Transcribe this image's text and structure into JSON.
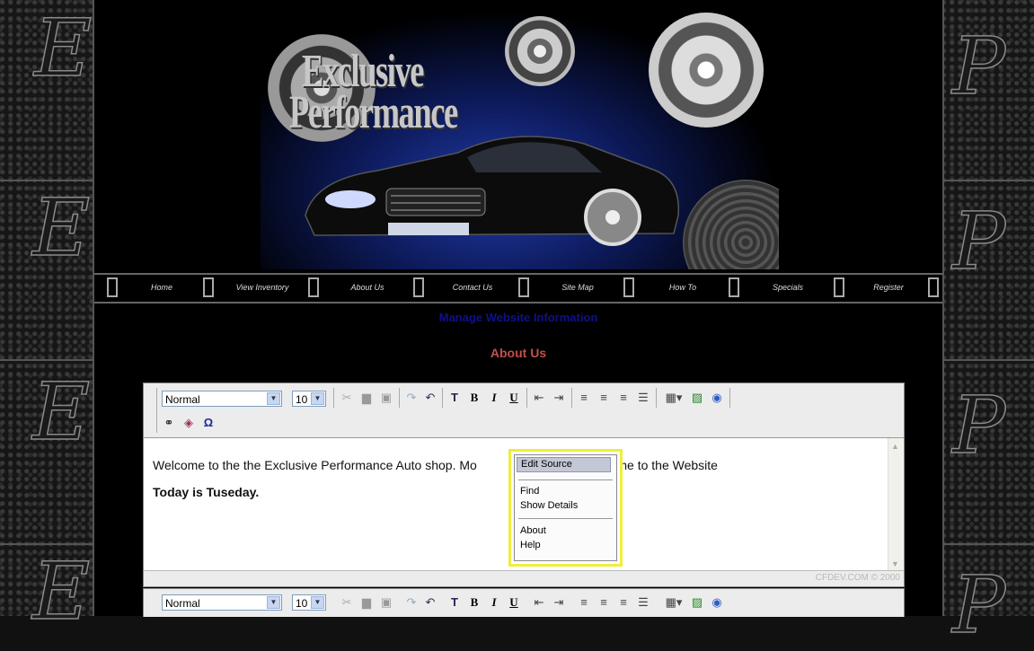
{
  "banner": {
    "logo_line1": "Exclusive",
    "logo_line2": "Performance"
  },
  "side": {
    "letters": [
      "E",
      "P"
    ]
  },
  "nav": {
    "items": [
      "Home",
      "View Inventory",
      "About Us",
      "Contact Us",
      "Site Map",
      "How To",
      "Specials",
      "Register"
    ]
  },
  "page": {
    "manage_title": "Manage Website Information",
    "section_title": "About Us"
  },
  "editor": {
    "format_select": "Normal",
    "size_select": "10",
    "content_line1": "Welcome to the the Exclusive Performance Auto shop. Mo",
    "content_line1_tail": "r. Any Welcome to the Website",
    "content_line2": "Today is Tuseday.",
    "footer_text": "CFDEV.COM © 2000",
    "icons": [
      "cut-icon",
      "copy-icon",
      "paste-icon",
      "redo-icon",
      "undo-icon",
      "text-color-icon",
      "bold-icon",
      "italic-icon",
      "underline-icon",
      "outdent-icon",
      "indent-icon",
      "align-left-icon",
      "align-center-icon",
      "align-right-icon",
      "bullet-list-icon",
      "table-icon",
      "image-icon",
      "link-icon",
      "find-icon",
      "spellcheck-icon",
      "special-char-icon"
    ]
  },
  "context_menu": {
    "items": [
      "Edit Source",
      "Find",
      "Show Details",
      "About",
      "Help"
    ]
  },
  "colors": {
    "manage_title": "#10108a",
    "section_title": "#c0504d",
    "highlight": "#f0ee3a"
  }
}
